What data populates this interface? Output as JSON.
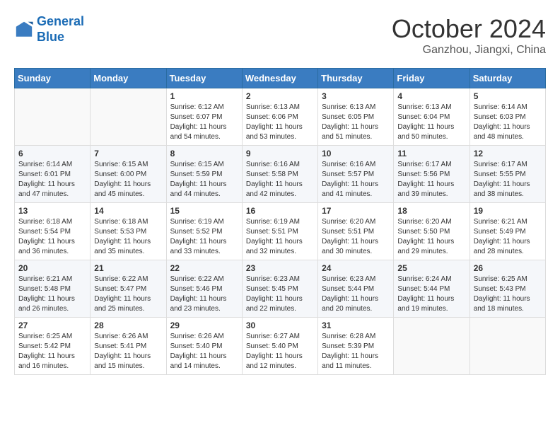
{
  "logo": {
    "line1": "General",
    "line2": "Blue"
  },
  "title": "October 2024",
  "location": "Ganzhou, Jiangxi, China",
  "weekdays": [
    "Sunday",
    "Monday",
    "Tuesday",
    "Wednesday",
    "Thursday",
    "Friday",
    "Saturday"
  ],
  "weeks": [
    [
      {
        "day": "",
        "info": ""
      },
      {
        "day": "",
        "info": ""
      },
      {
        "day": "1",
        "info": "Sunrise: 6:12 AM\nSunset: 6:07 PM\nDaylight: 11 hours and 54 minutes."
      },
      {
        "day": "2",
        "info": "Sunrise: 6:13 AM\nSunset: 6:06 PM\nDaylight: 11 hours and 53 minutes."
      },
      {
        "day": "3",
        "info": "Sunrise: 6:13 AM\nSunset: 6:05 PM\nDaylight: 11 hours and 51 minutes."
      },
      {
        "day": "4",
        "info": "Sunrise: 6:13 AM\nSunset: 6:04 PM\nDaylight: 11 hours and 50 minutes."
      },
      {
        "day": "5",
        "info": "Sunrise: 6:14 AM\nSunset: 6:03 PM\nDaylight: 11 hours and 48 minutes."
      }
    ],
    [
      {
        "day": "6",
        "info": "Sunrise: 6:14 AM\nSunset: 6:01 PM\nDaylight: 11 hours and 47 minutes."
      },
      {
        "day": "7",
        "info": "Sunrise: 6:15 AM\nSunset: 6:00 PM\nDaylight: 11 hours and 45 minutes."
      },
      {
        "day": "8",
        "info": "Sunrise: 6:15 AM\nSunset: 5:59 PM\nDaylight: 11 hours and 44 minutes."
      },
      {
        "day": "9",
        "info": "Sunrise: 6:16 AM\nSunset: 5:58 PM\nDaylight: 11 hours and 42 minutes."
      },
      {
        "day": "10",
        "info": "Sunrise: 6:16 AM\nSunset: 5:57 PM\nDaylight: 11 hours and 41 minutes."
      },
      {
        "day": "11",
        "info": "Sunrise: 6:17 AM\nSunset: 5:56 PM\nDaylight: 11 hours and 39 minutes."
      },
      {
        "day": "12",
        "info": "Sunrise: 6:17 AM\nSunset: 5:55 PM\nDaylight: 11 hours and 38 minutes."
      }
    ],
    [
      {
        "day": "13",
        "info": "Sunrise: 6:18 AM\nSunset: 5:54 PM\nDaylight: 11 hours and 36 minutes."
      },
      {
        "day": "14",
        "info": "Sunrise: 6:18 AM\nSunset: 5:53 PM\nDaylight: 11 hours and 35 minutes."
      },
      {
        "day": "15",
        "info": "Sunrise: 6:19 AM\nSunset: 5:52 PM\nDaylight: 11 hours and 33 minutes."
      },
      {
        "day": "16",
        "info": "Sunrise: 6:19 AM\nSunset: 5:51 PM\nDaylight: 11 hours and 32 minutes."
      },
      {
        "day": "17",
        "info": "Sunrise: 6:20 AM\nSunset: 5:51 PM\nDaylight: 11 hours and 30 minutes."
      },
      {
        "day": "18",
        "info": "Sunrise: 6:20 AM\nSunset: 5:50 PM\nDaylight: 11 hours and 29 minutes."
      },
      {
        "day": "19",
        "info": "Sunrise: 6:21 AM\nSunset: 5:49 PM\nDaylight: 11 hours and 28 minutes."
      }
    ],
    [
      {
        "day": "20",
        "info": "Sunrise: 6:21 AM\nSunset: 5:48 PM\nDaylight: 11 hours and 26 minutes."
      },
      {
        "day": "21",
        "info": "Sunrise: 6:22 AM\nSunset: 5:47 PM\nDaylight: 11 hours and 25 minutes."
      },
      {
        "day": "22",
        "info": "Sunrise: 6:22 AM\nSunset: 5:46 PM\nDaylight: 11 hours and 23 minutes."
      },
      {
        "day": "23",
        "info": "Sunrise: 6:23 AM\nSunset: 5:45 PM\nDaylight: 11 hours and 22 minutes."
      },
      {
        "day": "24",
        "info": "Sunrise: 6:23 AM\nSunset: 5:44 PM\nDaylight: 11 hours and 20 minutes."
      },
      {
        "day": "25",
        "info": "Sunrise: 6:24 AM\nSunset: 5:44 PM\nDaylight: 11 hours and 19 minutes."
      },
      {
        "day": "26",
        "info": "Sunrise: 6:25 AM\nSunset: 5:43 PM\nDaylight: 11 hours and 18 minutes."
      }
    ],
    [
      {
        "day": "27",
        "info": "Sunrise: 6:25 AM\nSunset: 5:42 PM\nDaylight: 11 hours and 16 minutes."
      },
      {
        "day": "28",
        "info": "Sunrise: 6:26 AM\nSunset: 5:41 PM\nDaylight: 11 hours and 15 minutes."
      },
      {
        "day": "29",
        "info": "Sunrise: 6:26 AM\nSunset: 5:40 PM\nDaylight: 11 hours and 14 minutes."
      },
      {
        "day": "30",
        "info": "Sunrise: 6:27 AM\nSunset: 5:40 PM\nDaylight: 11 hours and 12 minutes."
      },
      {
        "day": "31",
        "info": "Sunrise: 6:28 AM\nSunset: 5:39 PM\nDaylight: 11 hours and 11 minutes."
      },
      {
        "day": "",
        "info": ""
      },
      {
        "day": "",
        "info": ""
      }
    ]
  ]
}
